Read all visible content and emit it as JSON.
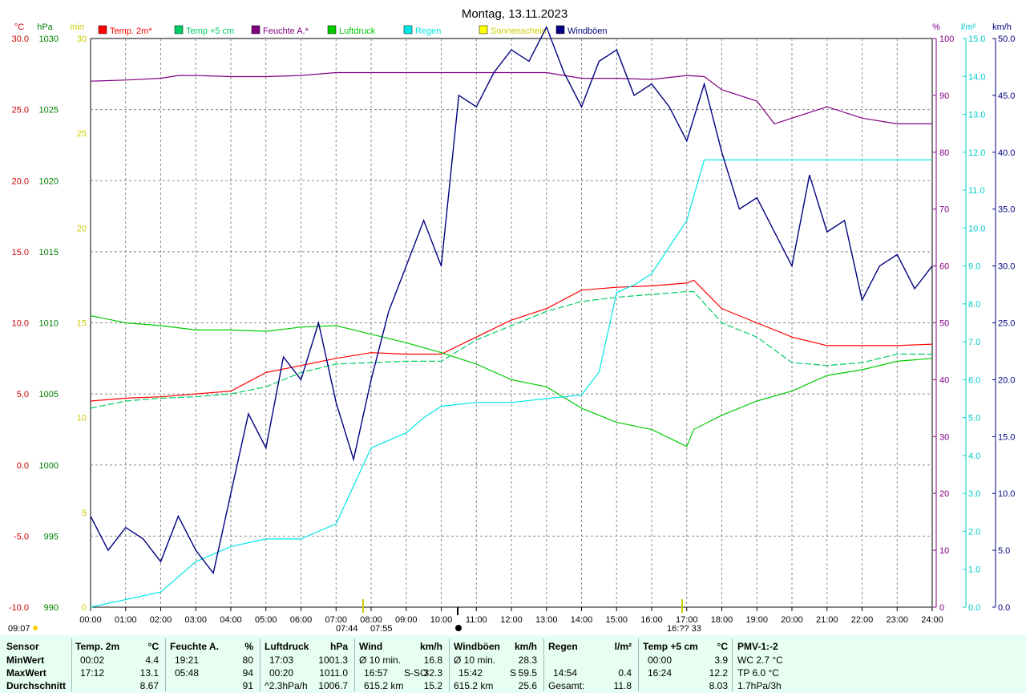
{
  "title": "Montag, 13.11.2023",
  "axes": {
    "temp": {
      "unit": "°C",
      "ticks": [
        "30.0",
        "25.0",
        "20.0",
        "15.0",
        "10.0",
        "5.0",
        "0.0",
        "-5.0",
        "-10.0"
      ],
      "color": "#cc0000"
    },
    "pressure": {
      "unit": "hPa",
      "ticks": [
        "1030",
        "1025",
        "1020",
        "1015",
        "1010",
        "1005",
        "1000",
        "995",
        "990"
      ],
      "color": "#008000"
    },
    "sun": {
      "unit": "min",
      "ticks": [
        "30",
        "25",
        "20",
        "15",
        "10",
        "5",
        "0"
      ],
      "color": "#cccc00"
    },
    "humidity": {
      "unit": "%",
      "ticks": [
        "100",
        "90",
        "80",
        "70",
        "60",
        "50",
        "40",
        "30",
        "20",
        "10",
        "0"
      ],
      "color": "#800080"
    },
    "rain": {
      "unit": "l/m²",
      "ticks": [
        "15.0",
        "14.0",
        "13.0",
        "12.0",
        "11.0",
        "10.0",
        "9.0",
        "8.0",
        "7.0",
        "6.0",
        "5.0",
        "4.0",
        "3.0",
        "2.0",
        "1.0",
        "0.0"
      ],
      "color": "#00cccc"
    },
    "wind": {
      "unit": "km/h",
      "ticks": [
        "50.0",
        "45.0",
        "40.0",
        "35.0",
        "30.0",
        "25.0",
        "20.0",
        "15.0",
        "10.0",
        "5.0",
        "0.0"
      ],
      "color": "#000080"
    }
  },
  "time_ticks": [
    "00:00",
    "01:00",
    "02:00",
    "03:00",
    "04:00",
    "05:00",
    "06:00",
    "07:00",
    "08:00",
    "09:00",
    "10:00",
    "11:00",
    "12:00",
    "13:00",
    "14:00",
    "15:00",
    "16:00",
    "17:00",
    "18:00",
    "19:00",
    "20:00",
    "21:00",
    "22:00",
    "23:00",
    "24:00"
  ],
  "legend": [
    {
      "label": "Temp. 2m*",
      "color": "#ff0000"
    },
    {
      "label": "Temp +5 cm",
      "color": "#00cc66"
    },
    {
      "label": "Feuchte A.*",
      "color": "#800080"
    },
    {
      "label": "Luftdruck",
      "color": "#00cc00"
    },
    {
      "label": "Regen",
      "color": "#00e5e5"
    },
    {
      "label": "Sonnenschein",
      "color": "#ffff00"
    },
    {
      "label": "Windböen",
      "color": "#000080"
    }
  ],
  "sun_markers": {
    "sunset_left": "09:07",
    "sunrise": "07:44",
    "sunrise2": "07:55",
    "sunset": "16:?? 33"
  },
  "chart_data": {
    "type": "line",
    "title": "Montag, 13.11.2023",
    "x_range": [
      "00:00",
      "24:00"
    ],
    "series": [
      {
        "name": "Temp. 2m*",
        "axis": "temp",
        "x": [
          0,
          1,
          2,
          3,
          4,
          5,
          6,
          7,
          8,
          9,
          10,
          11,
          12,
          13,
          14,
          15,
          16,
          17,
          17.2,
          18,
          19,
          20,
          21,
          22,
          23,
          24
        ],
        "values": [
          4.5,
          4.7,
          4.8,
          5.0,
          5.2,
          6.5,
          7.0,
          7.5,
          7.9,
          7.8,
          7.8,
          9.0,
          10.2,
          11.0,
          12.3,
          12.5,
          12.6,
          12.8,
          13.0,
          11.0,
          10.0,
          9.0,
          8.4,
          8.4,
          8.4,
          8.5
        ]
      },
      {
        "name": "Temp +5 cm",
        "axis": "temp",
        "x": [
          0,
          1,
          2,
          3,
          4,
          5,
          6,
          7,
          8,
          9,
          10,
          11,
          12,
          13,
          14,
          15,
          16,
          17,
          17.2,
          18,
          19,
          20,
          21,
          22,
          23,
          24
        ],
        "values": [
          4.0,
          4.5,
          4.7,
          4.8,
          5.0,
          5.5,
          6.5,
          7.1,
          7.2,
          7.3,
          7.3,
          8.8,
          9.8,
          10.8,
          11.5,
          11.8,
          12.0,
          12.2,
          12.2,
          10.0,
          9.0,
          7.2,
          7.0,
          7.2,
          7.8,
          7.8
        ]
      },
      {
        "name": "Feuchte A.*",
        "axis": "humidity",
        "x": [
          0,
          1,
          2,
          2.5,
          3,
          4,
          5,
          6,
          7,
          8,
          9,
          10,
          11,
          12,
          13,
          14,
          15,
          16,
          17,
          17.5,
          18,
          19,
          19.5,
          20,
          21,
          22,
          23,
          24
        ],
        "values": [
          92.5,
          92.7,
          93,
          93.5,
          93.5,
          93.3,
          93.3,
          93.5,
          94,
          94,
          94,
          94,
          94,
          94,
          94,
          93,
          93,
          92.8,
          93.5,
          93.3,
          91,
          89,
          85,
          86,
          88,
          86,
          85,
          85
        ]
      },
      {
        "name": "Luftdruck",
        "axis": "pressure",
        "x": [
          0,
          1,
          2,
          3,
          4,
          5,
          6,
          7,
          8,
          9,
          10,
          11,
          12,
          13,
          14,
          15,
          16,
          17,
          17.2,
          18,
          19,
          20,
          21,
          22,
          23,
          24
        ],
        "values": [
          1010.5,
          1010,
          1009.8,
          1009.5,
          1009.5,
          1009.4,
          1009.7,
          1009.8,
          1009.2,
          1008.6,
          1007.9,
          1007.1,
          1006,
          1005.5,
          1004,
          1003,
          1002.5,
          1001.3,
          1002.5,
          1003.5,
          1004.5,
          1005.2,
          1006.3,
          1006.7,
          1007.3,
          1007.5
        ]
      },
      {
        "name": "Regen",
        "axis": "rain",
        "x": [
          0,
          1,
          2,
          3,
          4,
          5,
          6,
          7,
          8,
          9,
          9.5,
          10,
          11,
          12,
          13,
          14,
          14.5,
          15,
          15.5,
          16,
          16.5,
          17,
          17.5,
          18,
          19,
          20,
          21,
          22,
          23,
          24
        ],
        "values": [
          0,
          0.2,
          0.4,
          1.2,
          1.6,
          1.8,
          1.8,
          2.2,
          4.2,
          4.6,
          5,
          5.3,
          5.4,
          5.4,
          5.5,
          5.6,
          6.2,
          8.3,
          8.5,
          8.8,
          9.5,
          10.2,
          11.8,
          11.8,
          11.8,
          11.8,
          11.8,
          11.8,
          11.8,
          11.8
        ]
      },
      {
        "name": "Windböen",
        "axis": "wind",
        "x": [
          0,
          0.5,
          1,
          1.5,
          2,
          2.5,
          3,
          3.5,
          4,
          4.5,
          5,
          5.5,
          6,
          6.5,
          7,
          7.5,
          8,
          8.5,
          9,
          9.5,
          10,
          10.5,
          11,
          11.5,
          12,
          12.5,
          13,
          13.5,
          14,
          14.5,
          15,
          15.5,
          16,
          16.5,
          17,
          17.5,
          18,
          18.5,
          19,
          19.5,
          20,
          20.5,
          21,
          21.5,
          22,
          22.5,
          23,
          23.5,
          24
        ],
        "values": [
          8,
          5,
          7,
          6,
          4,
          8,
          5,
          3,
          10,
          17,
          14,
          22,
          20,
          25,
          18,
          13,
          20,
          26,
          30,
          34,
          30,
          45,
          44,
          47,
          49,
          48,
          51,
          47,
          44,
          48,
          49,
          45,
          46,
          44,
          41,
          46,
          40,
          35,
          36,
          33,
          30,
          38,
          33,
          34,
          27,
          30,
          31,
          28,
          30
        ]
      }
    ]
  },
  "footer": {
    "sensor": {
      "head": "Sensor",
      "rows": [
        "MinWert",
        "MaxWert",
        "Durchschnitt"
      ]
    },
    "temp": {
      "head": "Temp. 2m",
      "unit": "°C",
      "rows": [
        [
          "00:02",
          "4.4"
        ],
        [
          "17:12",
          "13.1"
        ],
        [
          "",
          "8.67"
        ]
      ]
    },
    "hum": {
      "head": "Feuchte A.",
      "unit": "%",
      "rows": [
        [
          "19:21",
          "80"
        ],
        [
          "05:48",
          "94"
        ],
        [
          "",
          "91"
        ]
      ]
    },
    "press": {
      "head": "Luftdruck",
      "unit": "hPa",
      "rows": [
        [
          "17:03",
          "1001.3"
        ],
        [
          "00:20",
          "1011.0"
        ],
        [
          "^2.3hPa/h",
          "1006.7"
        ]
      ]
    },
    "wind": {
      "head": "Wind",
      "unit": "km/h",
      "rows": [
        [
          "Ø 10 min.",
          "",
          "16.8"
        ],
        [
          "16:57",
          "S-SO",
          "32.3"
        ],
        [
          "615.2 km",
          "",
          "15.2"
        ]
      ]
    },
    "gust": {
      "head": "Windböen",
      "unit": "km/h",
      "rows": [
        [
          "Ø 10 min.",
          "",
          "28.3"
        ],
        [
          "15:42",
          "S",
          "59.5"
        ],
        [
          "615.2 km",
          "",
          "25.6"
        ]
      ]
    },
    "rain": {
      "head": "Regen",
      "unit": "l/m²",
      "rows": [
        [
          "",
          ""
        ],
        [
          "14:54",
          "0.4"
        ],
        [
          "Gesamt:",
          "11.8"
        ]
      ]
    },
    "t5": {
      "head": "Temp +5 cm",
      "unit": "°C",
      "rows": [
        [
          "00:00",
          "3.9"
        ],
        [
          "16:24",
          "12.2"
        ],
        [
          "",
          "8.03"
        ]
      ]
    },
    "pmv": {
      "head": "PMV-1:-2",
      "rows": [
        "WC 2.7 °C",
        "TP 6.0 °C",
        "1.7hPa/3h"
      ]
    }
  }
}
